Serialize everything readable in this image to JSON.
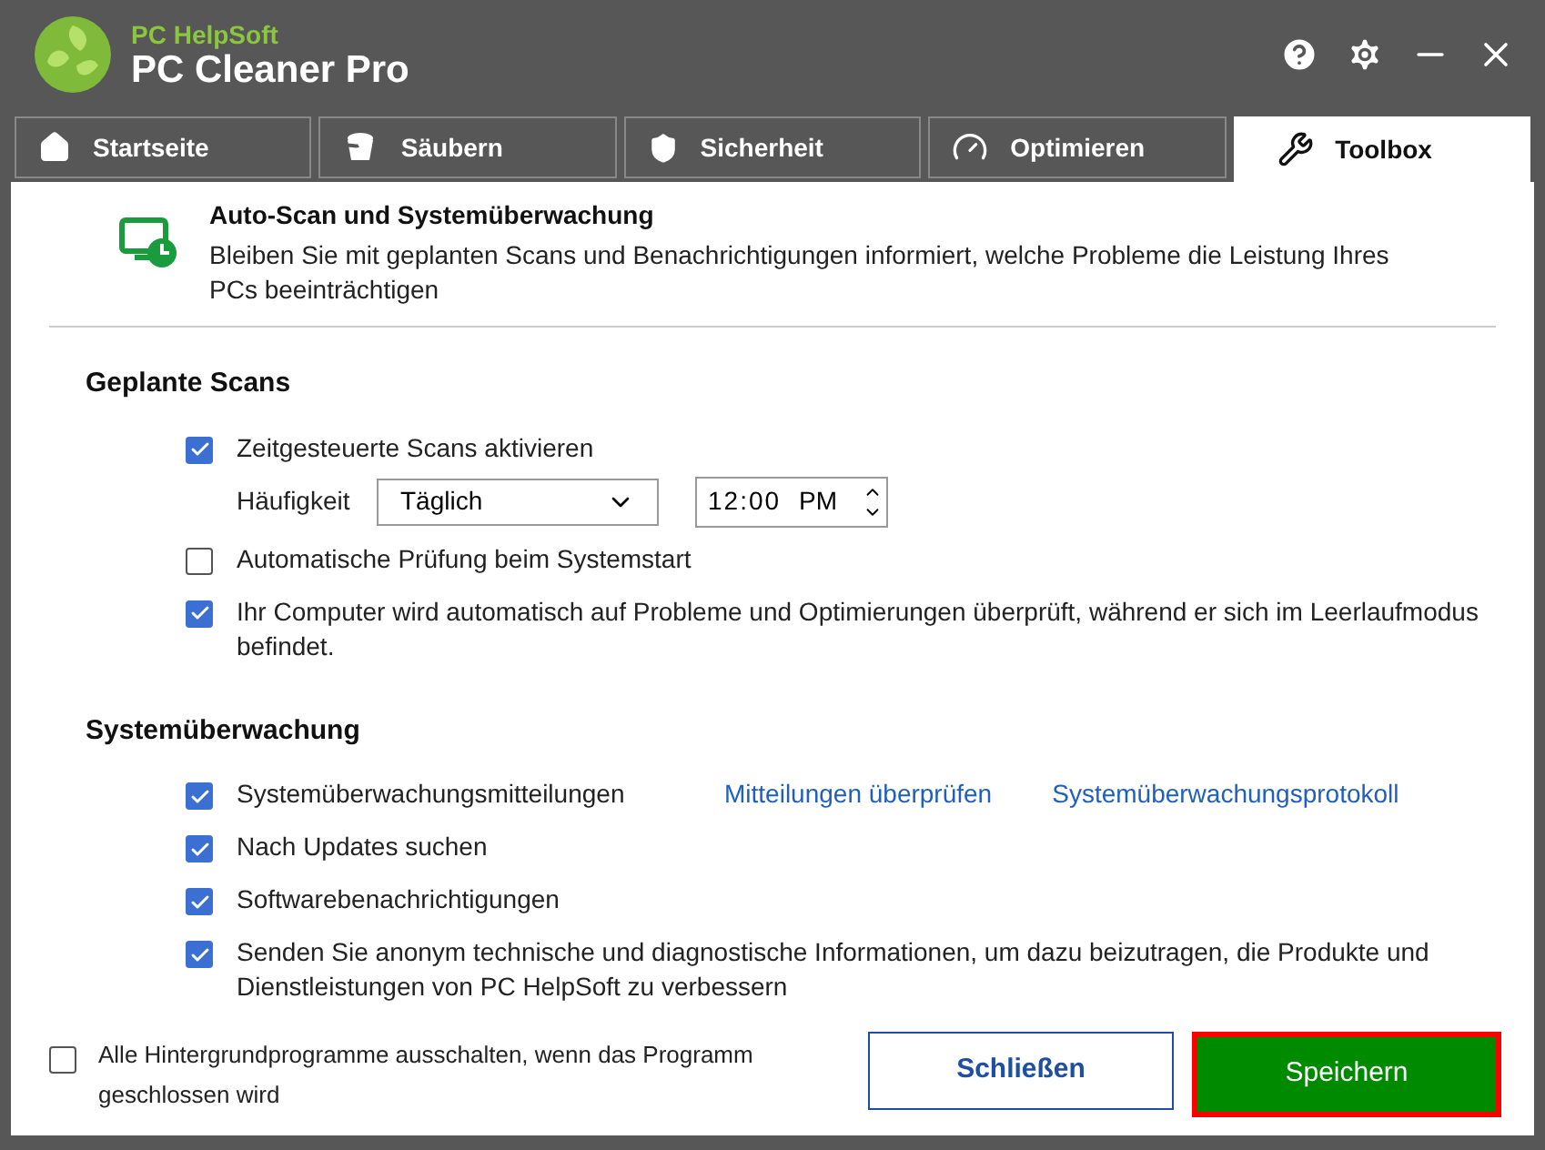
{
  "app": {
    "brand": "PC HelpSoft",
    "title": "PC Cleaner Pro"
  },
  "tabs": [
    {
      "label": "Startseite",
      "selected": false
    },
    {
      "label": "Säubern",
      "selected": false
    },
    {
      "label": "Sicherheit",
      "selected": false
    },
    {
      "label": "Optimieren",
      "selected": false
    },
    {
      "label": "Toolbox",
      "selected": true
    }
  ],
  "header": {
    "title": "Auto-Scan und Systemüberwachung",
    "description": "Bleiben Sie mit geplanten Scans und Benachrichtigungen informiert, welche Probleme die Leistung Ihres PCs beeinträchtigen"
  },
  "sections": [
    {
      "title": "Geplante Scans",
      "items": [
        {
          "kind": "checkbox",
          "label": "Zeitgesteuerte Scans aktivieren",
          "checked": true
        },
        {
          "kind": "schedule",
          "label": "Häufigkeit",
          "select": "Täglich",
          "time": "12:00",
          "period": "PM"
        },
        {
          "kind": "checkbox",
          "label": "Automatische Prüfung beim Systemstart",
          "checked": false
        },
        {
          "kind": "checkbox",
          "label": "Ihr Computer wird automatisch auf Probleme und Optimierungen überprüft, während er sich im Leerlaufmodus befindet.",
          "checked": true
        }
      ]
    },
    {
      "title": "Systemüberwachung",
      "items": [
        {
          "kind": "checkbox",
          "label": "Systemüberwachungsmitteilungen",
          "checked": true,
          "links": [
            "Mitteilungen überprüfen",
            "Systemüberwachungsprotokoll"
          ]
        },
        {
          "kind": "checkbox",
          "label": "Nach Updates suchen",
          "checked": true
        },
        {
          "kind": "checkbox",
          "label": "Softwarebenachrichtigungen",
          "checked": true
        },
        {
          "kind": "checkbox",
          "label": "Senden Sie anonym technische und diagnostische Informationen, um dazu beizutragen, die Produkte und Dienstleistungen von PC HelpSoft zu verbessern",
          "checked": true
        }
      ]
    }
  ],
  "footer": {
    "option": {
      "label": "Alle Hintergrundprogramme ausschalten, wenn das Programm geschlossen wird",
      "checked": false
    },
    "buttons": [
      {
        "label": "Schließen",
        "kind": "secondary"
      },
      {
        "label": "Speichern",
        "kind": "primary"
      }
    ]
  }
}
